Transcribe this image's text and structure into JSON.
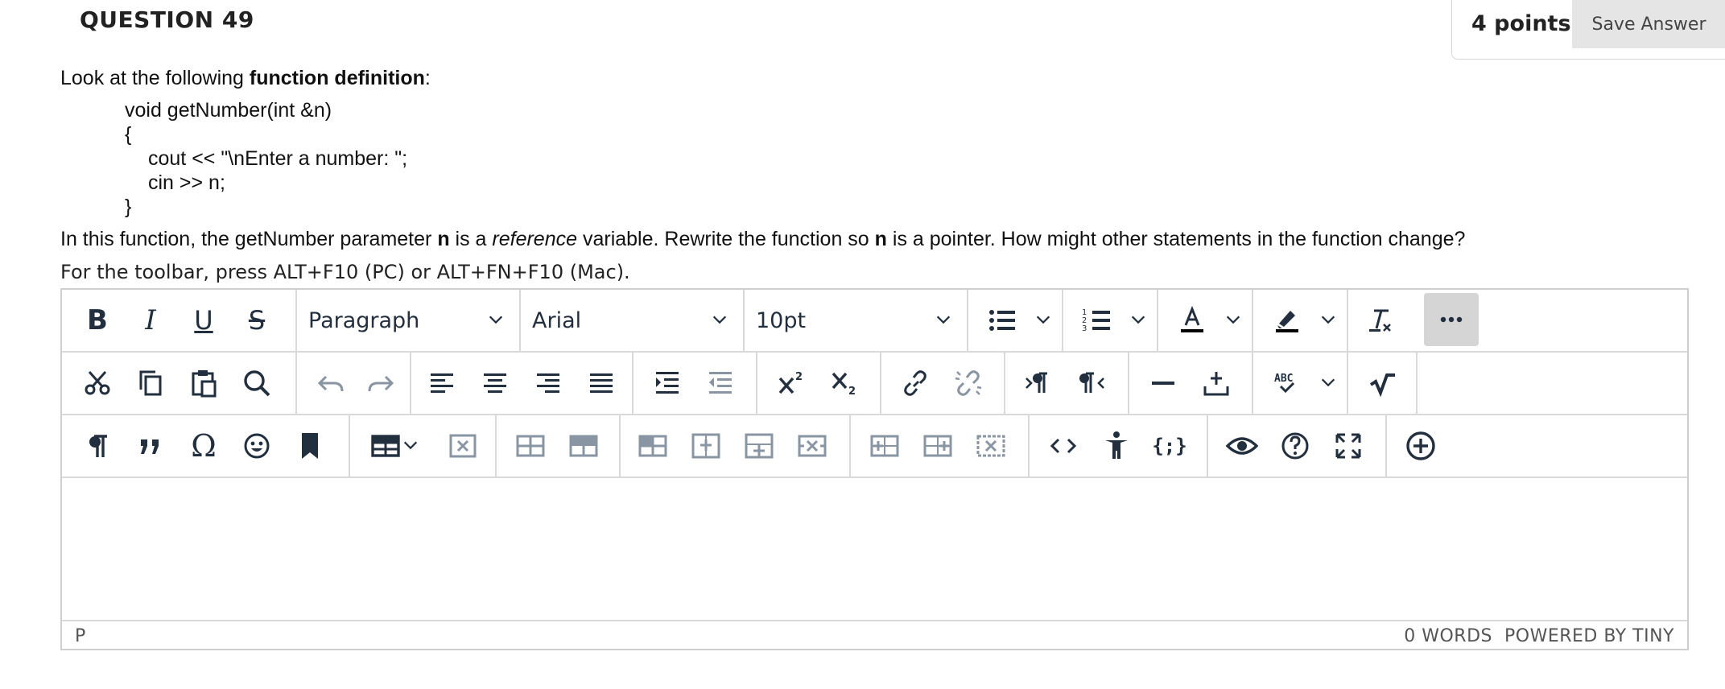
{
  "question": {
    "title": "QUESTION 49",
    "points": "4 points",
    "save_label": "Save Answer",
    "intro_prefix": "Look at the following ",
    "intro_bold": "function definition",
    "intro_suffix": ":",
    "code_lines": [
      "void getNumber(int &n)",
      "{",
      "cout << \"\\nEnter a number: \";",
      "cin >> n;",
      "}"
    ],
    "body_1": "In this function, the getNumber parameter ",
    "body_bold_1": "n",
    "body_2": " is a ",
    "body_italic": "reference",
    "body_3": " variable. Rewrite the function so ",
    "body_bold_2": "n",
    "body_4": " is a pointer. How might other statements in the function change?"
  },
  "editor": {
    "toolbar_hint": "For the toolbar, press ALT+F10 (PC) or ALT+FN+F10 (Mac).",
    "block_format": "Paragraph",
    "font_family": "Arial",
    "font_size": "10pt",
    "status_path": "P",
    "word_count": "0 WORDS",
    "powered_by": "POWERED BY TINY"
  }
}
